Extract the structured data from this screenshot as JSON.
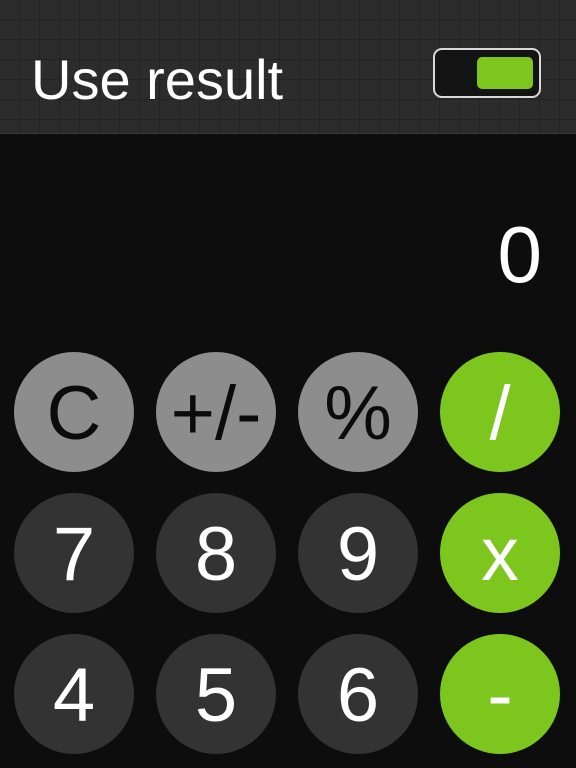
{
  "header": {
    "title": "Use result",
    "toggle": {
      "on": true,
      "accent_color": "#7dc61e"
    }
  },
  "display": {
    "value": "0"
  },
  "keypad": {
    "rows": [
      [
        "C",
        "+/-",
        "%",
        "/"
      ],
      [
        "7",
        "8",
        "9",
        "x"
      ],
      [
        "4",
        "5",
        "6",
        "-"
      ]
    ]
  },
  "colors": {
    "function_key": "#8d8d8d",
    "number_key": "#333333",
    "operator_key": "#7dc61e",
    "background": "#0d0d0d"
  }
}
